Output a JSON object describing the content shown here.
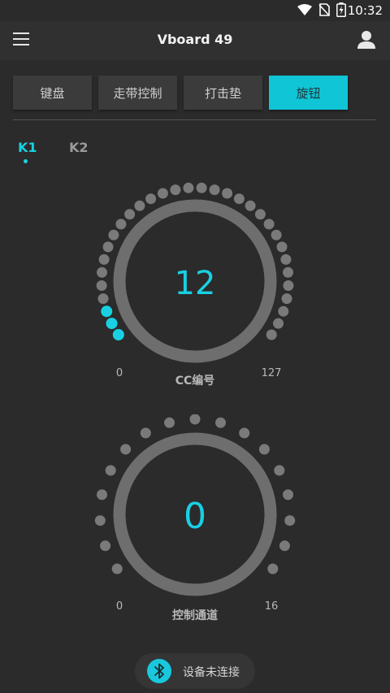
{
  "status_bar": {
    "time": "10:32"
  },
  "header": {
    "title": "Vboard 49"
  },
  "tabs": [
    {
      "label": "键盘",
      "active": false
    },
    {
      "label": "走带控制",
      "active": false
    },
    {
      "label": "打击垫",
      "active": false
    },
    {
      "label": "旋钮",
      "active": true
    }
  ],
  "knob_tabs": [
    {
      "label": "K1",
      "active": true
    },
    {
      "label": "K2",
      "active": false
    }
  ],
  "cc_knob": {
    "value": "12",
    "min": "0",
    "max": "127",
    "label": "CC编号",
    "lit_dots": 3,
    "total_dots": 32
  },
  "channel_knob": {
    "value": "0",
    "min": "0",
    "max": "16",
    "label": "控制通道",
    "lit_dots": 0,
    "total_dots": 17
  },
  "bluetooth": {
    "status": "设备未连接"
  },
  "colors": {
    "accent": "#19d0e3",
    "background": "#2b2b2b",
    "ring": "#6e6e6e",
    "dot": "#7a7a7a"
  }
}
